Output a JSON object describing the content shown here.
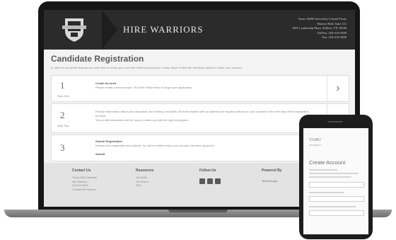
{
  "site": {
    "program_name": "HIRE WARRIORS",
    "contact": {
      "line1": "Texas A&M University-Central Texas",
      "line2": "Warrior Hall, Suite 111",
      "line3": "1001 Leadership Place, Killeen, TX 76549",
      "line4": "Tel/Fax: 254-519-5499",
      "line5": "Fax: 254-519-5499"
    }
  },
  "page": {
    "title": "Candidate Registration",
    "intro": "In order to use all the features you will need to create your new Hire Warriors account in 3 easy steps. Follow the directions below to create your account."
  },
  "steps": [
    {
      "number": "1",
      "label": "Step One",
      "heading": "Create Account",
      "text": "Please create a new account. Fill in the fields below to begin your application."
    },
    {
      "number": "2",
      "label": "Step Two",
      "heading": "",
      "text": "Provide information about your education, work history, and skills. All fields marked with an asterisk are required before you can continue to the next step of the registration process.",
      "text2": "Your profile information will be used to match you with the right employers."
    },
    {
      "number": "3",
      "label": "",
      "heading": "Submit Registration",
      "text": "Review your registration and submit. You will be notified once your account has been approved.",
      "text2": "Submit"
    }
  ],
  "footer": {
    "contact_heading": "Contact Us",
    "contact_links": [
      "Texas A&M University",
      "Hire Warriors",
      "254-519-5499",
      "Contact Hire Warriors"
    ],
    "resources_heading": "Resources",
    "resource_links": [
      "My Profile",
      "Job Search",
      "FAQ"
    ],
    "follow_heading": "Follow Us",
    "powered_heading": "Powered By",
    "powered_text": "TechnoLogic"
  },
  "phone": {
    "logo": "TAMU",
    "logo_sub": "UNIVERSITY",
    "title": "Create Account"
  }
}
